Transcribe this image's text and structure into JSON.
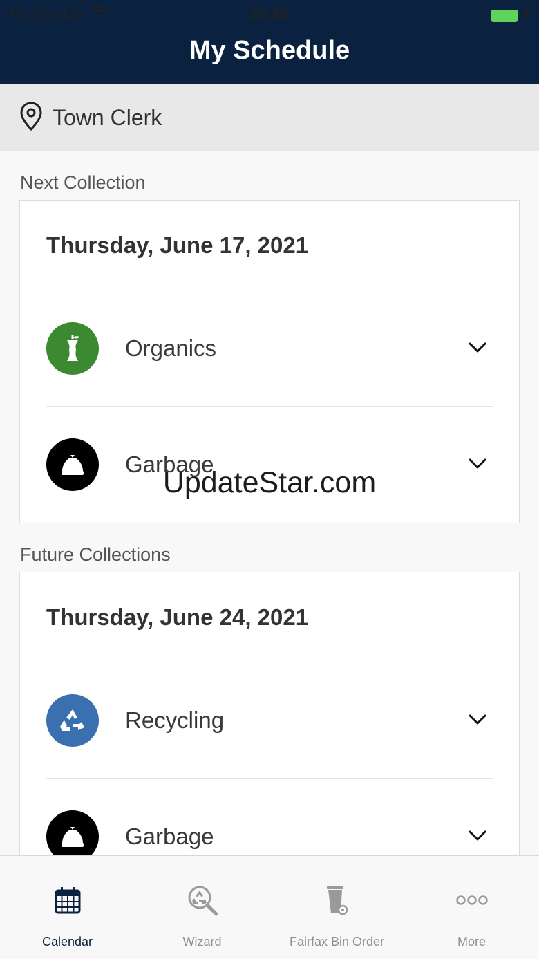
{
  "status_bar": {
    "carrier": "No Service",
    "time": "20:38"
  },
  "header": {
    "title": "My Schedule"
  },
  "location": {
    "name": "Town Clerk"
  },
  "next": {
    "label": "Next Collection",
    "date": "Thursday, June 17, 2021",
    "items": [
      {
        "label": "Organics",
        "icon": "apple-core-icon",
        "color": "#3b8a32"
      },
      {
        "label": "Garbage",
        "icon": "garbage-bag-icon",
        "color": "#000000"
      }
    ]
  },
  "future": {
    "label": "Future Collections",
    "date": "Thursday, June 24, 2021",
    "items": [
      {
        "label": "Recycling",
        "icon": "recycle-icon",
        "color": "#3a70b0"
      },
      {
        "label": "Garbage",
        "icon": "garbage-bag-icon",
        "color": "#000000"
      }
    ]
  },
  "watermark": "UpdateStar.com",
  "tabs": [
    {
      "label": "Calendar",
      "icon": "calendar-icon",
      "active": true
    },
    {
      "label": "Wizard",
      "icon": "recycle-search-icon",
      "active": false
    },
    {
      "label": "Fairfax Bin Order",
      "icon": "bin-icon",
      "active": false
    },
    {
      "label": "More",
      "icon": "more-icon",
      "active": false
    }
  ],
  "colors": {
    "navy": "#0b2140",
    "organics": "#3b8a32",
    "recycling": "#3a70b0",
    "battery": "#5fd35b"
  }
}
